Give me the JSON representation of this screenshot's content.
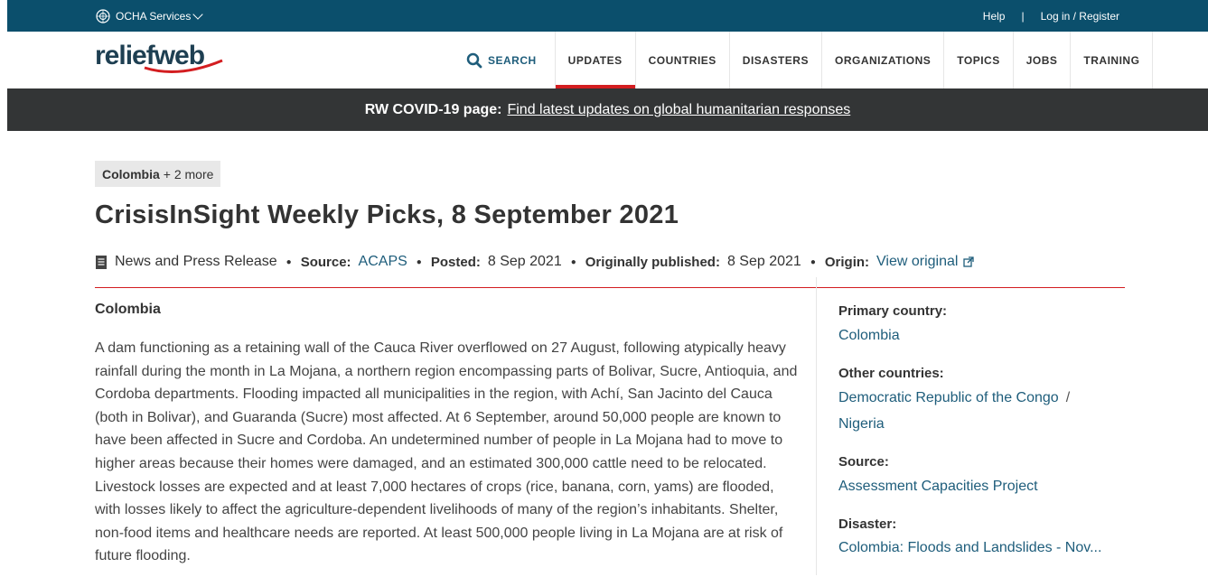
{
  "topbar": {
    "ocha_label": "OCHA Services",
    "help": "Help",
    "separator": "|",
    "login": "Log in / Register"
  },
  "header": {
    "logo_text_left": "relief",
    "logo_text_right": "web",
    "nav": {
      "search": "SEARCH",
      "items": [
        "UPDATES",
        "COUNTRIES",
        "DISASTERS",
        "ORGANIZATIONS",
        "TOPICS",
        "JOBS",
        "TRAINING"
      ],
      "active": "UPDATES"
    }
  },
  "banner": {
    "label": "RW COVID-19 page:",
    "link": "Find latest updates on global humanitarian responses"
  },
  "article": {
    "tag_country": "Colombia",
    "tag_more": "+ 2 more",
    "title": "CrisisInSight Weekly Picks, 8 September 2021",
    "meta": {
      "type": "News and Press Release",
      "source_label": "Source:",
      "source": "ACAPS",
      "posted_label": "Posted:",
      "posted": "8 Sep 2021",
      "orig_label": "Originally published:",
      "orig": "8 Sep 2021",
      "origin_label": "Origin:",
      "origin": "View original"
    },
    "section_heading": "Colombia",
    "paragraph": "A dam functioning as a retaining wall of the Cauca River overflowed on 27 August, following atypically heavy rainfall during the month in La Mojana, a northern region encompassing parts of Bolivar, Sucre, Antioquia, and Cordoba departments. Flooding impacted all municipalities in the region, with Achí, San Jacinto del Cauca (both in Bolivar), and Guaranda (Sucre) most affected. At 6 September, around 50,000 people are known to have been affected in Sucre and Cordoba. An undetermined number of people in La Mojana had to move to higher areas because their homes were damaged, and an estimated 300,000 cattle need to be relocated. Livestock losses are expected and at least 7,000 hectares of crops (rice, banana, corn, yams) are flooded, with losses likely to affect the agriculture-dependent livelihoods of many of the region’s inhabitants. Shelter, non-food items and healthcare needs are reported. At least 500,000 people living in La Mojana are at risk of future flooding."
  },
  "sidebar": {
    "primary_label": "Primary country:",
    "primary": "Colombia",
    "other_label": "Other countries:",
    "other_1": "Democratic Republic of the Congo",
    "other_sep": "/",
    "other_2": "Nigeria",
    "source_label": "Source:",
    "source": "Assessment Capacities Project",
    "disaster_label": "Disaster:",
    "disaster_partial": "Colombia: Floods and Landslides - Nov..."
  },
  "colors": {
    "topbar": "#0b4f6c",
    "accent_red": "#d31d20",
    "link_blue": "#1e5d7b",
    "banner": "#333536"
  }
}
